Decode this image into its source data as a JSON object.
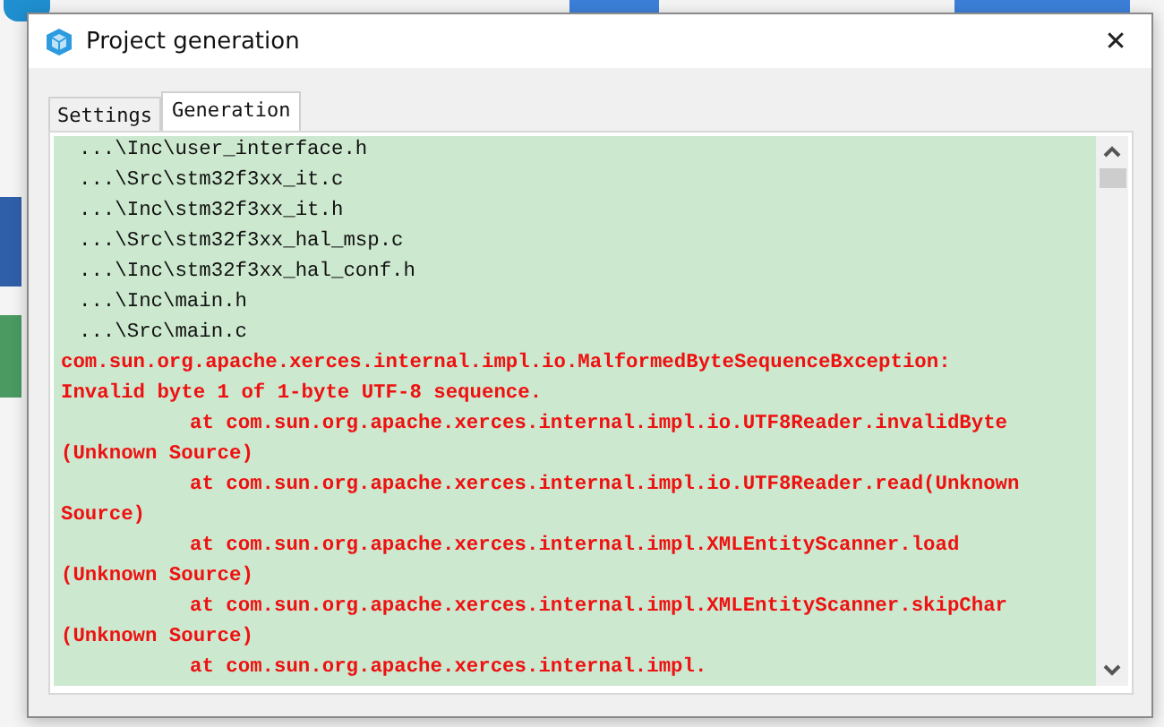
{
  "window": {
    "title": "Project generation",
    "close": "✕"
  },
  "tabs": [
    {
      "label": "Settings",
      "selected": false
    },
    {
      "label": "Generation",
      "selected": true
    }
  ],
  "log": [
    {
      "kind": "file",
      "text": "...\\Inc\\user_interface.h"
    },
    {
      "kind": "file",
      "text": "...\\Src\\stm32f3xx_it.c"
    },
    {
      "kind": "file",
      "text": "...\\Inc\\stm32f3xx_it.h"
    },
    {
      "kind": "file",
      "text": "...\\Src\\stm32f3xx_hal_msp.c"
    },
    {
      "kind": "file",
      "text": "...\\Inc\\stm32f3xx_hal_conf.h"
    },
    {
      "kind": "file",
      "text": "...\\Inc\\main.h"
    },
    {
      "kind": "file",
      "text": "...\\Src\\main.c"
    },
    {
      "kind": "error",
      "text": "com.sun.org.apache.xerces.internal.impl.io.MalformedByteSequenceBxception:"
    },
    {
      "kind": "error",
      "text": "Invalid byte 1 of 1-byte UTF-8 sequence."
    },
    {
      "kind": "trace",
      "text": "at com.sun.org.apache.xerces.internal.impl.io.UTF8Reader.invalidByte"
    },
    {
      "kind": "error",
      "text": "(Unknown Source)"
    },
    {
      "kind": "trace",
      "text": "at com.sun.org.apache.xerces.internal.impl.io.UTF8Reader.read(Unknown"
    },
    {
      "kind": "error",
      "text": "Source)"
    },
    {
      "kind": "trace",
      "text": "at com.sun.org.apache.xerces.internal.impl.XMLEntityScanner.load"
    },
    {
      "kind": "error",
      "text": "(Unknown Source)"
    },
    {
      "kind": "trace",
      "text": "at com.sun.org.apache.xerces.internal.impl.XMLEntityScanner.skipChar"
    },
    {
      "kind": "error",
      "text": "(Unknown Source)"
    },
    {
      "kind": "trace",
      "text": "at com.sun.org.apache.xerces.internal.impl."
    }
  ]
}
